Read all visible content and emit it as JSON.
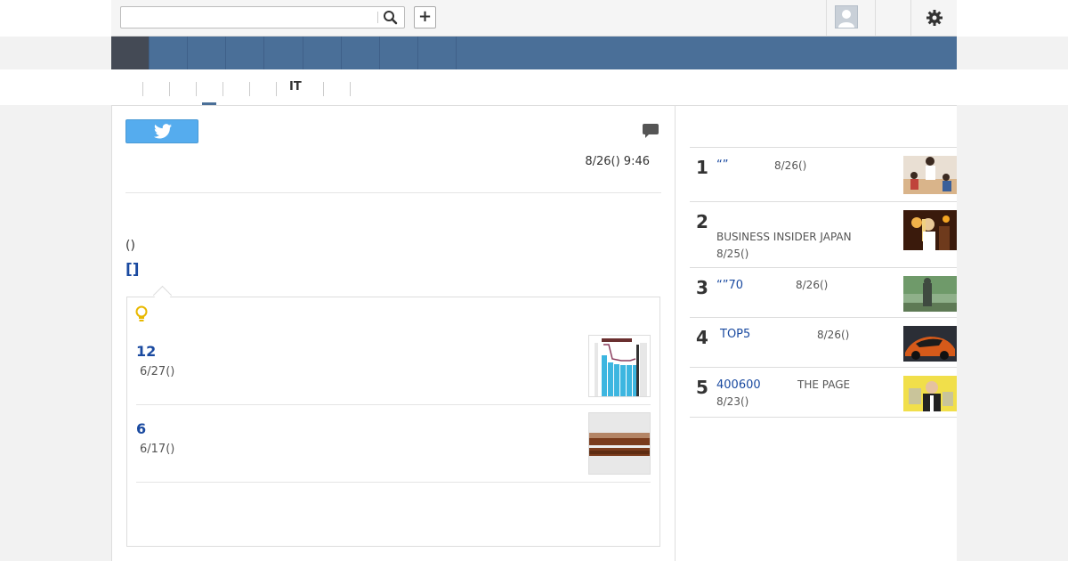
{
  "topbar": {
    "search": {
      "placeholder": "",
      "value": ""
    },
    "search_icon": "search-icon",
    "add_label": "+",
    "avatar_icon": "avatar",
    "settings_icon": "gear-icon"
  },
  "nav": {
    "item_count": 9,
    "active_index": 0
  },
  "subnav": {
    "it_label": "IT"
  },
  "article": {
    "share_icon": "twitter-icon",
    "comment_icon": "comment-icon",
    "date": "8/26() 9:46",
    "paren_text": "()",
    "bracket_link": "[]"
  },
  "related": {
    "icon": "lightbulb-icon",
    "items": [
      {
        "title": "12",
        "date": "6/27()"
      },
      {
        "title": "6",
        "date": "6/17()"
      }
    ]
  },
  "ranking": [
    {
      "rank": "1",
      "title": "“”",
      "source": "",
      "date": "8/26()"
    },
    {
      "rank": "2",
      "title": "",
      "source": "BUSINESS INSIDER JAPAN",
      "date": "8/25()"
    },
    {
      "rank": "3",
      "title": "“”70",
      "source": "",
      "date": "8/26()"
    },
    {
      "rank": "4",
      "title": "TOP5",
      "source": "",
      "date": "8/26()"
    },
    {
      "rank": "5",
      "title": "400600",
      "source": "THE PAGE",
      "date": "8/23()"
    }
  ]
}
